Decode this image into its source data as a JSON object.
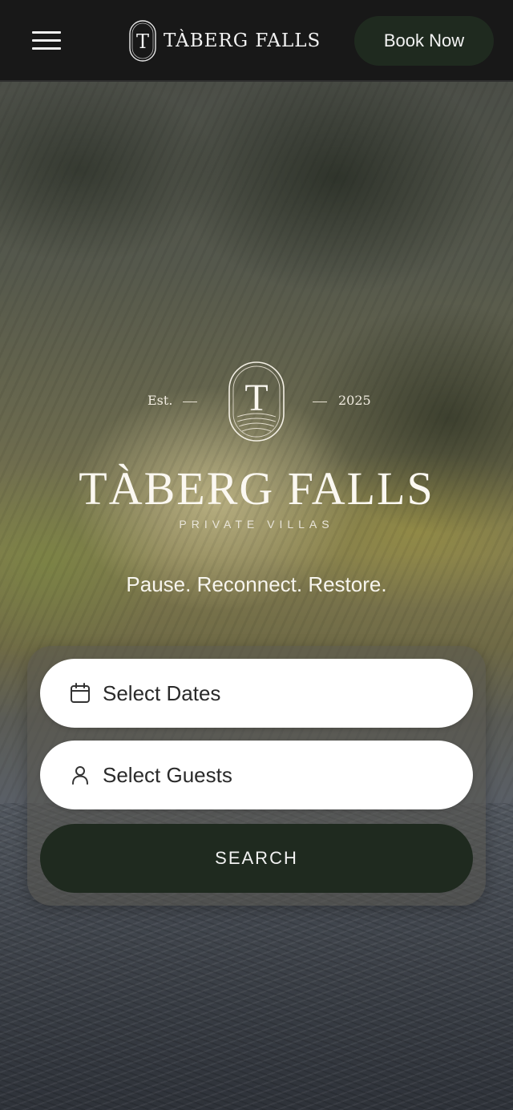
{
  "header": {
    "brand_name": "TÀBERG FALLS",
    "brand_initial": "T",
    "book_label": "Book Now"
  },
  "hero": {
    "est_label": "Est.",
    "est_year": "2025",
    "emblem_initial": "T",
    "title": "TÀBERG FALLS",
    "subtitle": "PRIVATE VILLAS",
    "tagline": "Pause. Reconnect. Restore."
  },
  "search": {
    "dates_label": "Select Dates",
    "guests_label": "Select Guests",
    "button_label": "SEARCH"
  },
  "icons": {
    "menu": "hamburger-icon",
    "dates": "calendar-icon",
    "guests": "user-icon"
  },
  "colors": {
    "header_bg": "#181818",
    "brand_green": "#1f2a1f",
    "text_light": "#f3f3f3",
    "field_bg": "#ffffff"
  }
}
